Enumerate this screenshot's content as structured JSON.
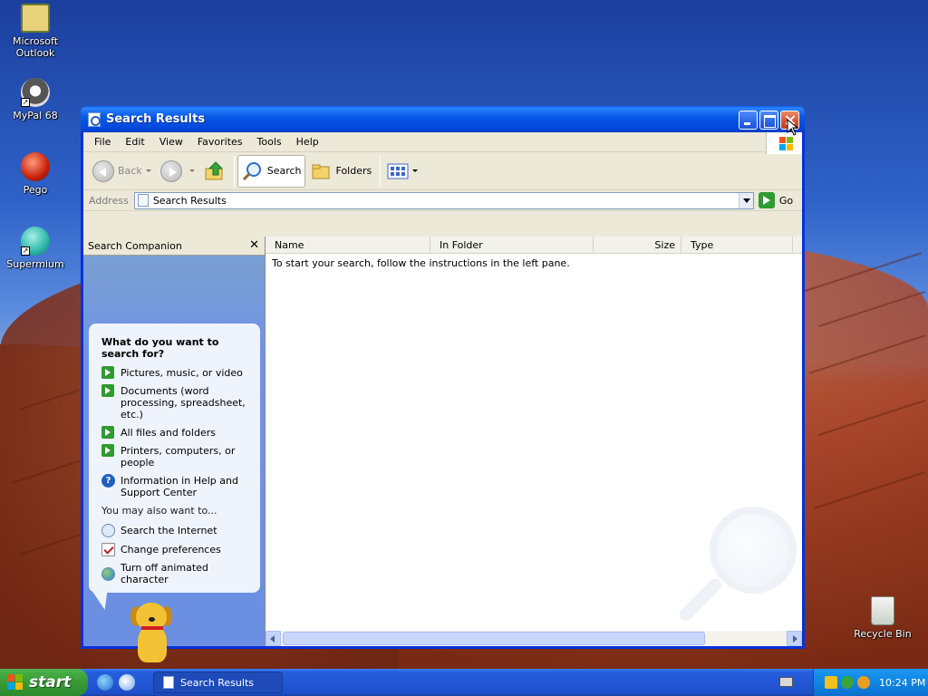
{
  "desktop": {
    "icons": [
      {
        "label": "Microsoft Outlook"
      },
      {
        "label": "MyPal 68"
      },
      {
        "label": "Pego"
      },
      {
        "label": "Supermium"
      },
      {
        "label": "Recycle Bin"
      }
    ]
  },
  "window": {
    "title": "Search Results",
    "menu": [
      "File",
      "Edit",
      "View",
      "Favorites",
      "Tools",
      "Help"
    ],
    "toolbar": {
      "back": "Back",
      "search": "Search",
      "folders": "Folders"
    },
    "address": {
      "label": "Address",
      "value": "Search Results",
      "go": "Go"
    },
    "companion": {
      "header": "Search Companion",
      "close": "✕",
      "question": "What do you want to search for?",
      "options": [
        "Pictures, music, or video",
        "Documents (word processing, spreadsheet, etc.)",
        "All files and folders",
        "Printers, computers, or people",
        "Information in Help and Support Center"
      ],
      "also_title": "You may also want to...",
      "also": [
        "Search the Internet",
        "Change preferences",
        "Turn off animated character"
      ]
    },
    "results": {
      "columns": [
        "Name",
        "In Folder",
        "Size",
        "Type"
      ],
      "empty_message": "To start your search, follow the instructions in the left pane."
    }
  },
  "taskbar": {
    "start": "start",
    "task_title": "Search Results",
    "clock": "10:24 PM"
  },
  "colors": {
    "titlebar": "#0054e3",
    "taskbar": "#245edb",
    "start": "#379a37",
    "pane": "#6f93e6"
  }
}
